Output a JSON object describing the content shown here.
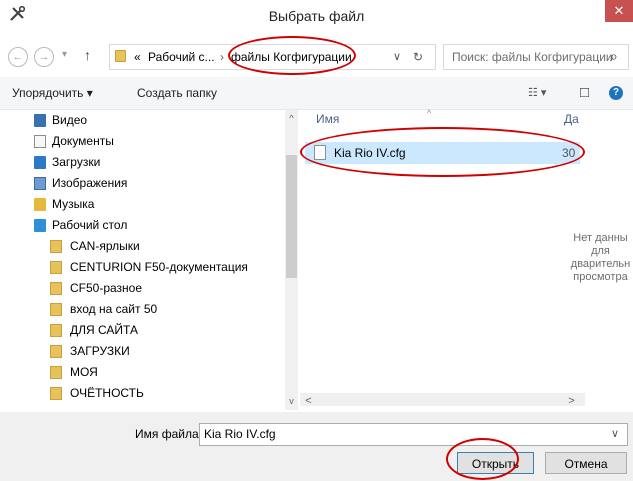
{
  "window": {
    "title": "Выбрать файл",
    "close_glyph": "✕",
    "tools_glyph": "✕"
  },
  "nav_buttons": {
    "back": "←",
    "forward": "→",
    "dropdown": "▾",
    "up": "↑"
  },
  "address": {
    "prefix": "«",
    "crumb1": "Рабочий с...",
    "sep": "›",
    "crumb2": "файлы Когфигурации",
    "dropdown": "∨",
    "refresh": "↻"
  },
  "search": {
    "placeholder": "Поиск: файлы Когфигурации",
    "icon": "⌕"
  },
  "toolbar": {
    "organize": "Упорядочить ▾",
    "new_folder": "Создать папку",
    "view_glyph": "☷ ▾",
    "pane_glyph": "□",
    "help_glyph": "?"
  },
  "sidebar": {
    "items": [
      {
        "label": "Видео",
        "icon": "video-library-icon",
        "indent": 0
      },
      {
        "label": "Документы",
        "icon": "documents-library-icon",
        "indent": 0
      },
      {
        "label": "Загрузки",
        "icon": "downloads-folder-icon",
        "indent": 0
      },
      {
        "label": "Изображения",
        "icon": "pictures-library-icon",
        "indent": 0
      },
      {
        "label": "Музыка",
        "icon": "music-library-icon",
        "indent": 0
      },
      {
        "label": "Рабочий стол",
        "icon": "desktop-folder-icon",
        "indent": 0
      },
      {
        "label": "CAN-ярлыки",
        "icon": "folder-icon",
        "indent": 1
      },
      {
        "label": "CENTURION F50-документация",
        "icon": "folder-icon",
        "indent": 1
      },
      {
        "label": "CF50-разное",
        "icon": "folder-icon",
        "indent": 1
      },
      {
        "label": "вход на сайт 50",
        "icon": "folder-icon",
        "indent": 1
      },
      {
        "label": "ДЛЯ САЙТА",
        "icon": "folder-icon",
        "indent": 1
      },
      {
        "label": "ЗАГРУЗКИ",
        "icon": "folder-icon",
        "indent": 1
      },
      {
        "label": "МОЯ",
        "icon": "folder-icon",
        "indent": 1
      },
      {
        "label": "ОЧЁТНОСТЬ",
        "icon": "folder-icon",
        "indent": 1
      }
    ]
  },
  "file_list": {
    "column_name": "Имя",
    "column_date": "Да",
    "sort_glyph": "^",
    "files": [
      {
        "name": "Kia Rio IV.cfg",
        "date": "30"
      }
    ]
  },
  "preview": {
    "line1": "Нет данны",
    "line2": "для",
    "line3": "дварительн",
    "line4": "просмотра"
  },
  "filename": {
    "label": "Имя файла:",
    "value": "Kia Rio IV.cfg",
    "dropdown": "∨"
  },
  "buttons": {
    "open": "Открыть",
    "cancel": "Отмена"
  },
  "scroll": {
    "up": "^",
    "down": "v",
    "left": "<",
    "right": ">"
  },
  "colors": {
    "selection": "#cce8ff",
    "annotation": "#d00000",
    "close": "#c75050"
  }
}
